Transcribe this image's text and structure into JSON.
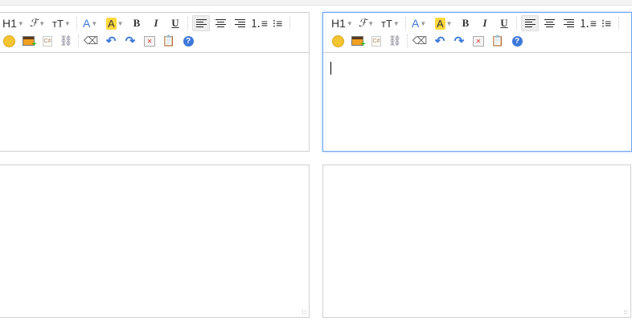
{
  "toolbar": {
    "heading": "H1",
    "font": "ℱ",
    "size": "ᴛT",
    "font_color": "A",
    "highlight": "A",
    "bold": "B",
    "italic": "I",
    "underline": "U",
    "code": "C#"
  },
  "colors": {
    "accent": "#6fa3f0",
    "highlight": "#ffd83d",
    "icon_blue": "#3b78d8"
  }
}
